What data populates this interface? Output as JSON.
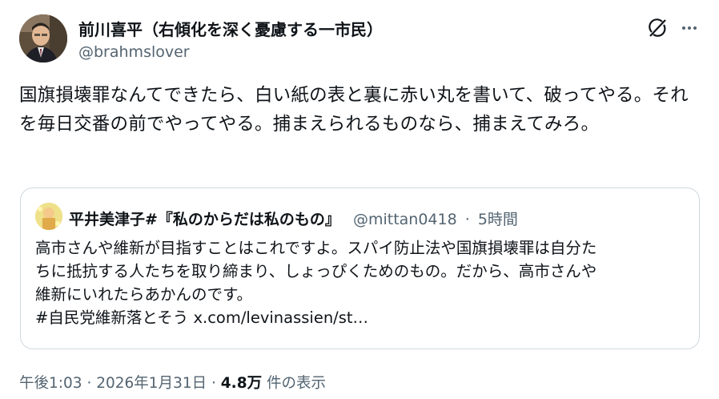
{
  "author": {
    "name": "前川喜平（右傾化を深く憂慮する一市民）",
    "handle": "@brahmslover"
  },
  "tweet": {
    "text": "国旗損壊罪なんてできたら、白い紙の表と裏に赤い丸を書いて、破ってやる。それを毎日交番の前でやってやる。捕まえられるものなら、捕まえてみろ。"
  },
  "quote": {
    "name": "平井美津子#『私のからだは私のもの』",
    "handle": "@mittan0418",
    "separator": "·",
    "time": "5時間",
    "line1": "高市さんや維新が目指すことはこれですよ。スパイ防止法や国旗損壊罪は自分た",
    "line2": "ちに抵抗する人たちを取り締まり、しょっぴくためのもの。だから、高市さんや",
    "line3": "維新にいれたらあかんのです。",
    "line4": "#自民党維新落とそう x.com/levinassien/st…"
  },
  "meta": {
    "time": "午後1:03",
    "sep1": "·",
    "date": "2026年1月31日",
    "sep2": "·",
    "views": "4.8万",
    "views_label": "件の表示"
  },
  "icons": {
    "grok": "grok-icon",
    "more": "more-icon"
  }
}
